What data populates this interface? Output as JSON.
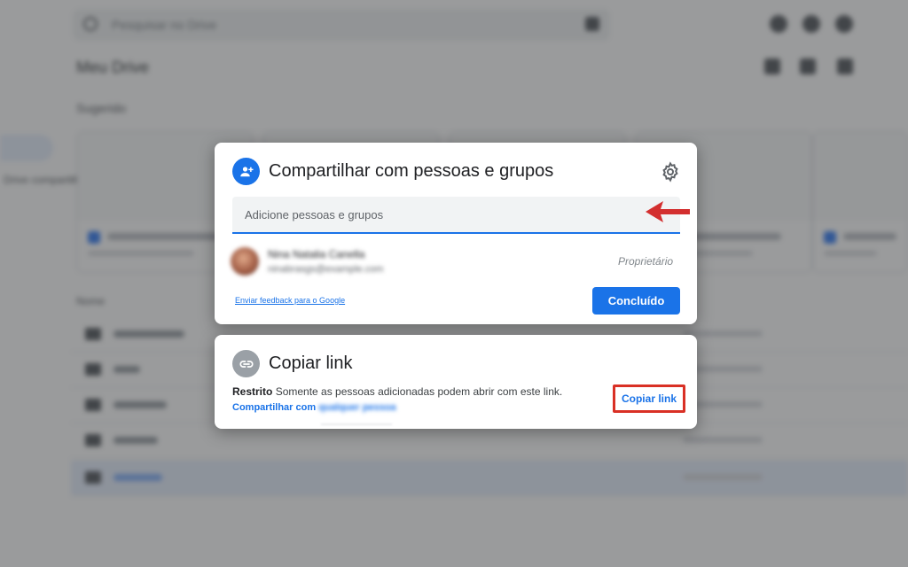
{
  "background": {
    "search_placeholder": "Pesquisar no Drive",
    "page_title": "Meu Drive",
    "suggested_label": "Sugerido",
    "sidebar_label": "Drive compartilhado",
    "list_header": "Nome"
  },
  "share_dialog": {
    "title": "Compartilhar com pessoas e grupos",
    "input_placeholder": "Adicione pessoas e grupos",
    "user": {
      "name": "Nina Natalia Canella",
      "email": "ninabrasgs@example.com",
      "role": "Proprietário"
    },
    "feedback_link": "Enviar feedback para o Google",
    "done_button": "Concluído",
    "icons": [
      "person-add-icon",
      "gear-icon",
      "red-arrow-icon"
    ]
  },
  "link_dialog": {
    "title": "Copiar link",
    "restriction_label": "Restrito",
    "restriction_text": "Somente as pessoas adicionadas podem abrir com este link.",
    "change_link_prefix": "Compartilhar com",
    "change_link_blurred": "qualquer pessoa",
    "copy_button": "Copiar link",
    "icons": [
      "link-icon"
    ]
  },
  "colors": {
    "accent": "#1a73e8",
    "highlight_red": "#d93025",
    "arrow_red": "#d32f2f"
  }
}
